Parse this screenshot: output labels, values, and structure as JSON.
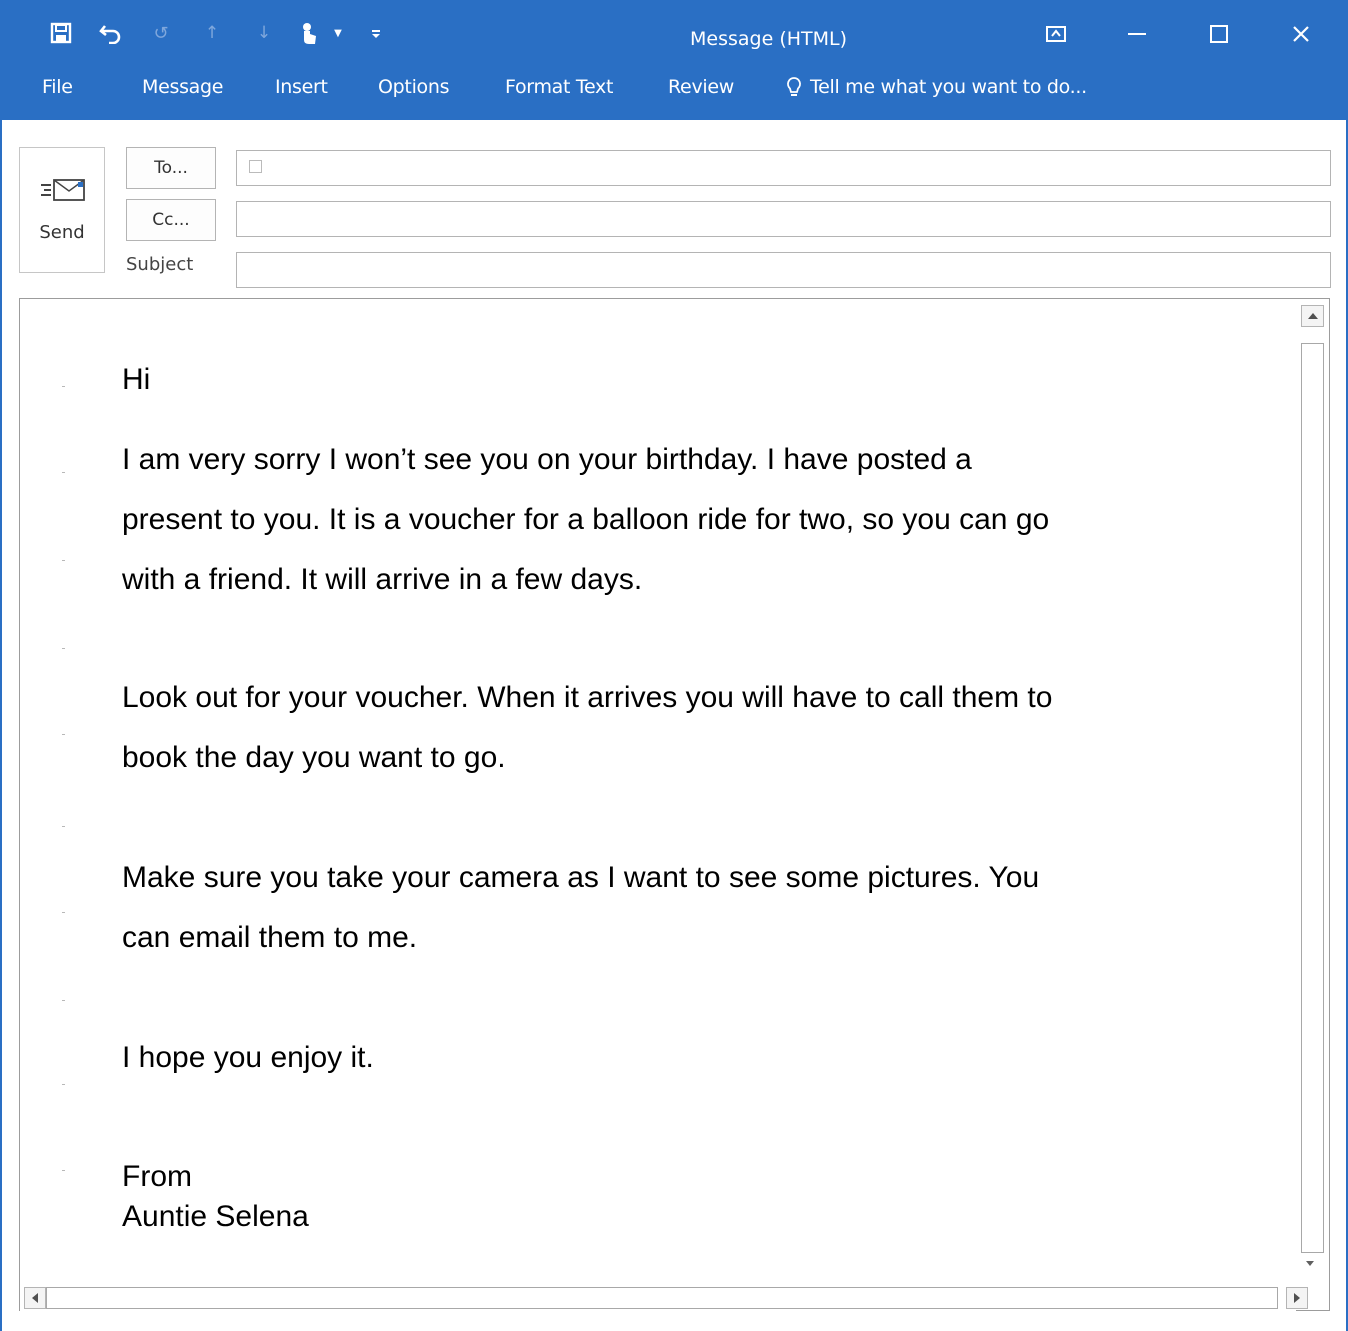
{
  "window": {
    "title": "Message (HTML)",
    "accent_color": "#2a6fc4"
  },
  "quick_access": {
    "save_icon": "save-icon",
    "undo_icon": "undo-icon",
    "redo_icon": "redo-icon",
    "up_icon": "arrow-up-icon",
    "down_icon": "arrow-down-icon",
    "touch_icon": "touch-mode-icon",
    "customize_icon": "customize-dropdown-icon"
  },
  "ribbon_tabs": [
    {
      "label": "File"
    },
    {
      "label": "Message"
    },
    {
      "label": "Insert"
    },
    {
      "label": "Options"
    },
    {
      "label": "Format Text"
    },
    {
      "label": "Review"
    }
  ],
  "tell_me": "Tell me what you want to do...",
  "header": {
    "send_label": "Send",
    "to_label": "To...",
    "cc_label": "Cc...",
    "subject_label": "Subject",
    "to_value": "",
    "cc_value": "",
    "subject_value": ""
  },
  "body": {
    "greeting": "Hi",
    "p1_line1": "I am very sorry I won’t see you on your birthday.  I have posted a",
    "p1_line2": "present to you.  It is a voucher for a balloon ride for two, so you can go",
    "p1_line3": "with a friend.  It will arrive in a few days.",
    "p2_line1": "Look out for your voucher.  When it arrives you will have to call them to",
    "p2_line2": "book the day you want to go.",
    "p3_line1": "Make sure you take your camera as I want to see some pictures.  You",
    "p3_line2": "can email them to me.",
    "p4": "I hope you enjoy it.",
    "sign_from": "From",
    "sign_name": "Auntie Selena"
  }
}
